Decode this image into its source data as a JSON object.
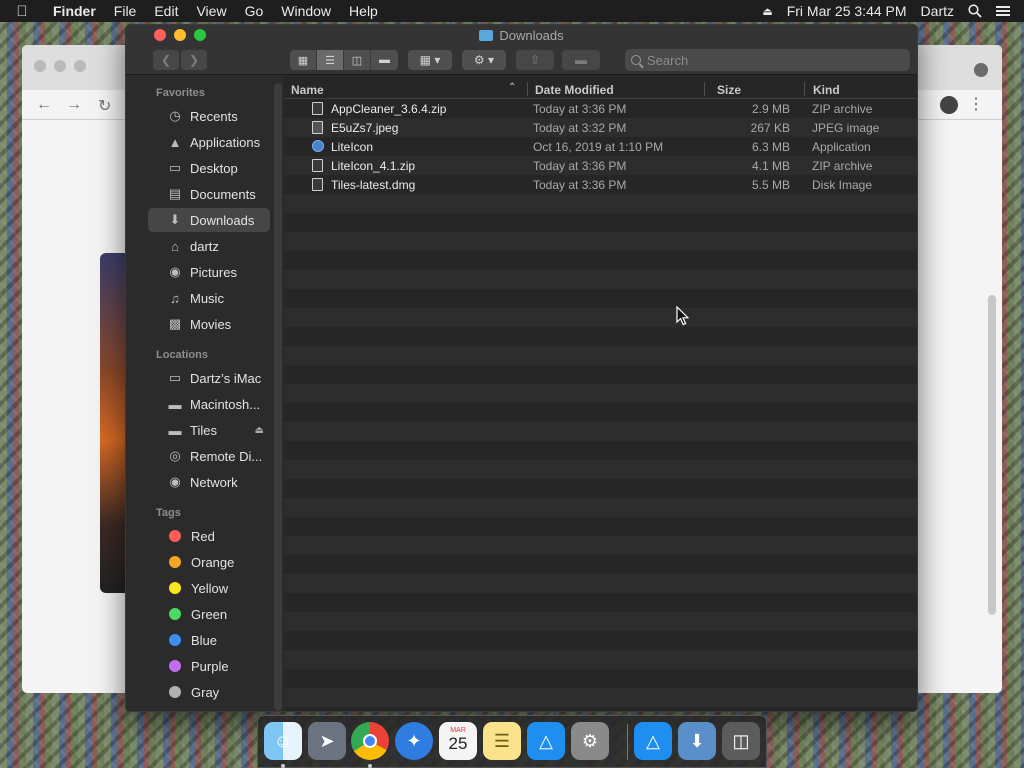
{
  "menubar": {
    "app_name": "Finder",
    "menus": [
      "File",
      "Edit",
      "View",
      "Go",
      "Window",
      "Help"
    ],
    "datetime": "Fri Mar 25  3:44 PM",
    "user": "Dartz"
  },
  "window": {
    "title": "Downloads",
    "search_placeholder": "Search"
  },
  "sidebar": {
    "favorites_label": "Favorites",
    "favorites": [
      {
        "label": "Recents",
        "icon": "clock-icon"
      },
      {
        "label": "Applications",
        "icon": "applications-icon"
      },
      {
        "label": "Desktop",
        "icon": "desktop-icon"
      },
      {
        "label": "Documents",
        "icon": "document-icon"
      },
      {
        "label": "Downloads",
        "icon": "download-icon",
        "selected": true
      },
      {
        "label": "dartz",
        "icon": "home-icon"
      },
      {
        "label": "Pictures",
        "icon": "camera-icon"
      },
      {
        "label": "Music",
        "icon": "music-icon"
      },
      {
        "label": "Movies",
        "icon": "film-icon"
      }
    ],
    "locations_label": "Locations",
    "locations": [
      {
        "label": "Dartz’s iMac",
        "icon": "computer-icon"
      },
      {
        "label": "Macintosh...",
        "icon": "drive-icon"
      },
      {
        "label": "Tiles",
        "icon": "drive-icon"
      },
      {
        "label": "Remote Di...",
        "icon": "disc-icon"
      },
      {
        "label": "Network",
        "icon": "globe-icon"
      }
    ],
    "tags_label": "Tags",
    "tags": [
      {
        "label": "Red",
        "color": "#ff5b57"
      },
      {
        "label": "Orange",
        "color": "#f5a623"
      },
      {
        "label": "Yellow",
        "color": "#f8e71c"
      },
      {
        "label": "Green",
        "color": "#4cd964"
      },
      {
        "label": "Blue",
        "color": "#3d8ff5"
      },
      {
        "label": "Purple",
        "color": "#c36df0"
      },
      {
        "label": "Gray",
        "color": "#b0b0b0"
      }
    ]
  },
  "list": {
    "columns": {
      "name": "Name",
      "date": "Date Modified",
      "size": "Size",
      "kind": "Kind"
    },
    "files": [
      {
        "name": "AppCleaner_3.6.4.zip",
        "date": "Today at 3:36 PM",
        "size": "2.9 MB",
        "kind": "ZIP archive",
        "icon": "zip-file-icon"
      },
      {
        "name": "E5uZs7.jpeg",
        "date": "Today at 3:32 PM",
        "size": "267 KB",
        "kind": "JPEG image",
        "icon": "image-file-icon"
      },
      {
        "name": "LiteIcon",
        "date": "Oct 16, 2019 at 1:10 PM",
        "size": "6.3 MB",
        "kind": "Application",
        "icon": "app-icon"
      },
      {
        "name": "LiteIcon_4.1.zip",
        "date": "Today at 3:36 PM",
        "size": "4.1 MB",
        "kind": "ZIP archive",
        "icon": "zip-file-icon"
      },
      {
        "name": "Tiles-latest.dmg",
        "date": "Today at 3:36 PM",
        "size": "5.5 MB",
        "kind": "Disk Image",
        "icon": "disk-image-icon"
      }
    ]
  },
  "dock": {
    "calendar_month": "MAR",
    "calendar_day": "25"
  },
  "colors": {
    "finder_bg": "#262626",
    "sidebar_bg": "#2b2b2b",
    "selection": "#464646",
    "close": "#ff5f57",
    "minimize": "#febc2e",
    "maximize": "#28c840"
  }
}
